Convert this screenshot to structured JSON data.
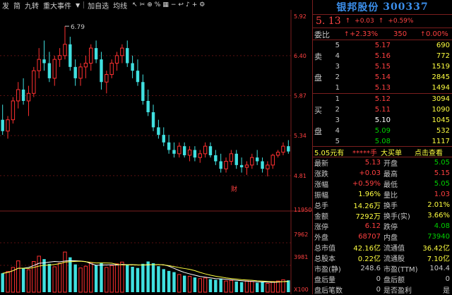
{
  "toolbar": {
    "items": [
      "发",
      "简",
      "九转",
      "重大事件",
      "加自选",
      "均线"
    ]
  },
  "chart": {
    "price_labels": [
      "5.92",
      "6.40",
      "5.87",
      "5.34",
      "4.81"
    ],
    "high_marker": "6.79",
    "vol_labels": [
      "11950",
      "7962",
      "3981",
      "X100"
    ],
    "finance_icon": "财"
  },
  "chart_data": {
    "type": "candlestick",
    "ylim": [
      4.5,
      6.95
    ],
    "ohlc": [
      [
        5.55,
        5.75,
        5.35,
        5.4
      ],
      [
        5.4,
        5.6,
        5.3,
        5.55
      ],
      [
        5.55,
        5.85,
        5.5,
        5.8
      ],
      [
        5.8,
        6.05,
        5.7,
        5.95
      ],
      [
        5.95,
        6.1,
        5.75,
        5.8
      ],
      [
        5.8,
        6.0,
        5.6,
        5.9
      ],
      [
        5.9,
        6.25,
        5.85,
        6.2
      ],
      [
        6.2,
        6.5,
        6.1,
        6.35
      ],
      [
        6.35,
        6.6,
        6.2,
        6.3
      ],
      [
        6.3,
        6.45,
        6.05,
        6.1
      ],
      [
        6.1,
        6.4,
        6.0,
        6.35
      ],
      [
        6.35,
        6.5,
        6.25,
        6.4
      ],
      [
        6.4,
        6.79,
        6.35,
        6.55
      ],
      [
        6.55,
        6.65,
        6.2,
        6.25
      ],
      [
        6.25,
        6.35,
        6.0,
        6.1
      ],
      [
        6.1,
        6.3,
        6.0,
        6.25
      ],
      [
        6.25,
        6.4,
        6.1,
        6.3
      ],
      [
        6.3,
        6.55,
        6.2,
        6.5
      ],
      [
        6.5,
        6.6,
        6.3,
        6.35
      ],
      [
        6.35,
        6.45,
        5.95,
        6.05
      ],
      [
        6.05,
        6.2,
        5.9,
        6.15
      ],
      [
        6.15,
        6.35,
        6.1,
        6.3
      ],
      [
        6.3,
        6.45,
        6.2,
        6.4
      ],
      [
        6.4,
        6.55,
        6.3,
        6.5
      ],
      [
        6.5,
        6.6,
        6.25,
        6.3
      ],
      [
        6.3,
        6.4,
        6.1,
        6.2
      ],
      [
        6.2,
        6.35,
        6.0,
        6.05
      ],
      [
        6.05,
        6.15,
        5.75,
        5.8
      ],
      [
        5.8,
        5.95,
        5.6,
        5.65
      ],
      [
        5.65,
        5.75,
        5.4,
        5.45
      ],
      [
        5.45,
        5.55,
        5.3,
        5.35
      ],
      [
        5.35,
        5.45,
        5.2,
        5.25
      ],
      [
        5.25,
        5.35,
        5.1,
        5.15
      ],
      [
        5.15,
        5.25,
        5.05,
        5.1
      ],
      [
        5.1,
        5.25,
        5.05,
        5.2
      ],
      [
        5.2,
        5.25,
        5.05,
        5.08
      ],
      [
        5.08,
        5.2,
        5.0,
        5.15
      ],
      [
        5.15,
        5.2,
        5.0,
        5.05
      ],
      [
        5.05,
        5.15,
        4.98,
        5.1
      ],
      [
        5.1,
        5.25,
        5.05,
        5.2
      ],
      [
        5.2,
        5.25,
        5.05,
        5.08
      ],
      [
        5.08,
        5.15,
        4.95,
        5.0
      ],
      [
        5.0,
        5.1,
        4.85,
        4.9
      ],
      [
        4.9,
        5.05,
        4.85,
        5.0
      ],
      [
        5.0,
        5.15,
        4.95,
        5.1
      ],
      [
        5.1,
        5.15,
        4.9,
        4.95
      ],
      [
        4.95,
        5.05,
        4.85,
        4.92
      ],
      [
        4.92,
        5.0,
        4.82,
        4.95
      ],
      [
        4.95,
        5.1,
        4.9,
        5.05
      ],
      [
        5.05,
        5.15,
        4.95,
        5.0
      ],
      [
        5.0,
        5.05,
        4.85,
        4.9
      ],
      [
        4.9,
        5.0,
        4.8,
        4.95
      ],
      [
        4.95,
        5.1,
        4.9,
        5.08
      ],
      [
        5.08,
        5.15,
        5.05,
        5.12
      ],
      [
        5.12,
        5.25,
        5.08,
        5.2
      ],
      [
        5.2,
        5.28,
        5.1,
        5.13
      ]
    ],
    "volume": [
      3200,
      3500,
      4200,
      5300,
      4100,
      3800,
      5200,
      6100,
      5600,
      4800,
      4300,
      4900,
      6800,
      5900,
      4700,
      4100,
      4400,
      5000,
      4600,
      4900,
      4200,
      4500,
      4800,
      5100,
      4700,
      4300,
      4100,
      4800,
      5200,
      4900,
      4400,
      3900,
      3600,
      3400,
      3000,
      2800,
      2700,
      2500,
      2300,
      2400,
      2200,
      2100,
      2300,
      1900,
      2000,
      1800,
      1700,
      1900,
      1800,
      1600,
      1700,
      1500,
      1800,
      1900,
      2100,
      2000
    ]
  },
  "quote": {
    "name": "银邦股份",
    "code": "300337",
    "price": "5. 13",
    "change": "+0.03",
    "change_pct": "+0.59%",
    "weibi_label": "委比",
    "weibi_pct": "+2.33%",
    "weibi_val": "350",
    "weibi_end": "0.00%",
    "sell_label": [
      "",
      "卖",
      "",
      "盘",
      ""
    ],
    "buy_label": [
      "",
      "买",
      "",
      "盘",
      ""
    ],
    "sells": [
      {
        "lv": "5",
        "price": "5.17",
        "vol": "690"
      },
      {
        "lv": "4",
        "price": "5.16",
        "vol": "772"
      },
      {
        "lv": "3",
        "price": "5.15",
        "vol": "1519"
      },
      {
        "lv": "2",
        "price": "5.14",
        "vol": "2845"
      },
      {
        "lv": "1",
        "price": "5.13",
        "vol": "1494"
      }
    ],
    "buys": [
      {
        "lv": "1",
        "price": "5.12",
        "vol": "3094"
      },
      {
        "lv": "2",
        "price": "5.11",
        "vol": "1090"
      },
      {
        "lv": "3",
        "price": "5.10",
        "vol": "1045"
      },
      {
        "lv": "4",
        "price": "5.09",
        "vol": "532"
      },
      {
        "lv": "5",
        "price": "5.08",
        "vol": "1117"
      }
    ],
    "mid_price": "5.05元有",
    "mid_stars": "*****手",
    "mid_big": "大买单",
    "mid_link": "点击查看",
    "stats": [
      {
        "k1": "最新",
        "v1": "5.13",
        "c1": "red",
        "k2": "开盘",
        "v2": "5.05",
        "c2": "grn"
      },
      {
        "k1": "涨跌",
        "v1": "+0.03",
        "c1": "red",
        "k2": "最高",
        "v2": "5.15",
        "c2": "red"
      },
      {
        "k1": "涨幅",
        "v1": "+0.59%",
        "c1": "red",
        "k2": "最低",
        "v2": "5.05",
        "c2": "grn"
      },
      {
        "k1": "振幅",
        "v1": "1.96%",
        "c1": "yel",
        "k2": "量比",
        "v2": "1.03",
        "c2": "red"
      },
      {
        "k1": "总手",
        "v1": "14.26万",
        "c1": "yel",
        "k2": "换手",
        "v2": "2.01%",
        "c2": "yel"
      },
      {
        "k1": "金额",
        "v1": "7292万",
        "c1": "yel",
        "k2": "换手(实)",
        "v2": "3.66%",
        "c2": "yel"
      },
      {
        "k1": "涨停",
        "v1": "6.12",
        "c1": "red",
        "k2": "跌停",
        "v2": "4.08",
        "c2": "grn"
      },
      {
        "k1": "外盘",
        "v1": "68707",
        "c1": "red",
        "k2": "内盘",
        "v2": "73940",
        "c2": "grn"
      },
      {
        "k1": "总市值",
        "v1": "42.16亿",
        "c1": "yel",
        "k2": "流通值",
        "v2": "36.42亿",
        "c2": "yel"
      },
      {
        "k1": "总股本",
        "v1": "0.22亿",
        "c1": "yel",
        "k2": "流通股",
        "v2": "7.10亿",
        "c2": "yel"
      },
      {
        "k1": "市盈(静)",
        "v1": "248.6",
        "c1": "gry",
        "k2": "市盈(TTM)",
        "v2": "104.4",
        "c2": "gry"
      },
      {
        "k1": "盘后量",
        "v1": "0",
        "c1": "gry",
        "k2": "盘后额",
        "v2": "0",
        "c2": "gry"
      },
      {
        "k1": "盘后笔数",
        "v1": "0",
        "c1": "gry",
        "k2": "是否盈利",
        "v2": "是",
        "c2": "gry"
      }
    ]
  },
  "colors": {
    "up": "#ff3030",
    "down": "#40e0e0",
    "border": "#7a1e1e",
    "accent": "#3b8eea"
  }
}
